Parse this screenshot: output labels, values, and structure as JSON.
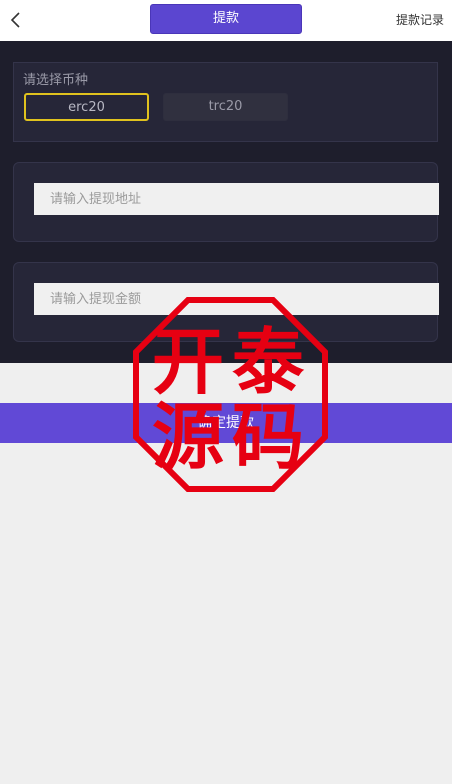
{
  "header": {
    "back_icon": "chevron-left-icon",
    "title": "提款",
    "record_link": "提款记录"
  },
  "coin_select": {
    "label": "请选择币种",
    "options": [
      {
        "label": "erc20",
        "selected": true
      },
      {
        "label": "trc20",
        "selected": false
      }
    ]
  },
  "address": {
    "placeholder": "请输入提现地址",
    "value": ""
  },
  "amount": {
    "placeholder": "请输入提现金额",
    "value": ""
  },
  "submit": {
    "label": "确定提款"
  },
  "watermark": {
    "text": "开泰源码"
  },
  "colors": {
    "accent": "#5b46d0",
    "selected_border": "#e0c21e",
    "stamp_red": "#e60012",
    "dark_bg": "#1e1e2c"
  }
}
